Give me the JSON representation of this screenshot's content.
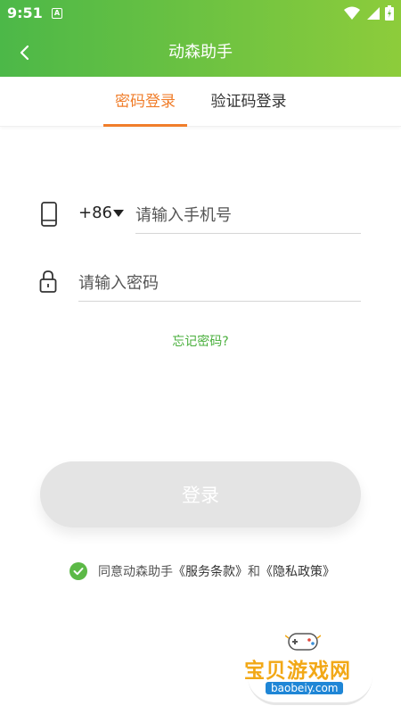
{
  "status": {
    "time": "9:51",
    "notif": "A"
  },
  "nav": {
    "title": "动森助手"
  },
  "tabs": [
    {
      "label": "密码登录",
      "active": true
    },
    {
      "label": "验证码登录",
      "active": false
    }
  ],
  "phone": {
    "country_code": "+86",
    "placeholder": "请输入手机号"
  },
  "password": {
    "placeholder": "请输入密码"
  },
  "forgot": {
    "label": "忘记密码?"
  },
  "login": {
    "label": "登录"
  },
  "agreement": {
    "prefix": "同意动森助手",
    "terms": "《服务条款》",
    "and": "和",
    "privacy": "《隐私政策》"
  },
  "watermark": {
    "title": "宝贝游戏网",
    "url": "baobeiy.com"
  },
  "colors": {
    "accent": "#f07d2a",
    "brand_start": "#4cb848",
    "brand_end": "#8dcc3b",
    "link": "#4aaf3d"
  },
  "icons": [
    "back-icon",
    "phone-icon",
    "dropdown-arrow-icon",
    "lock-icon",
    "check-circle-icon",
    "wifi-icon",
    "signal-icon",
    "battery-icon"
  ]
}
